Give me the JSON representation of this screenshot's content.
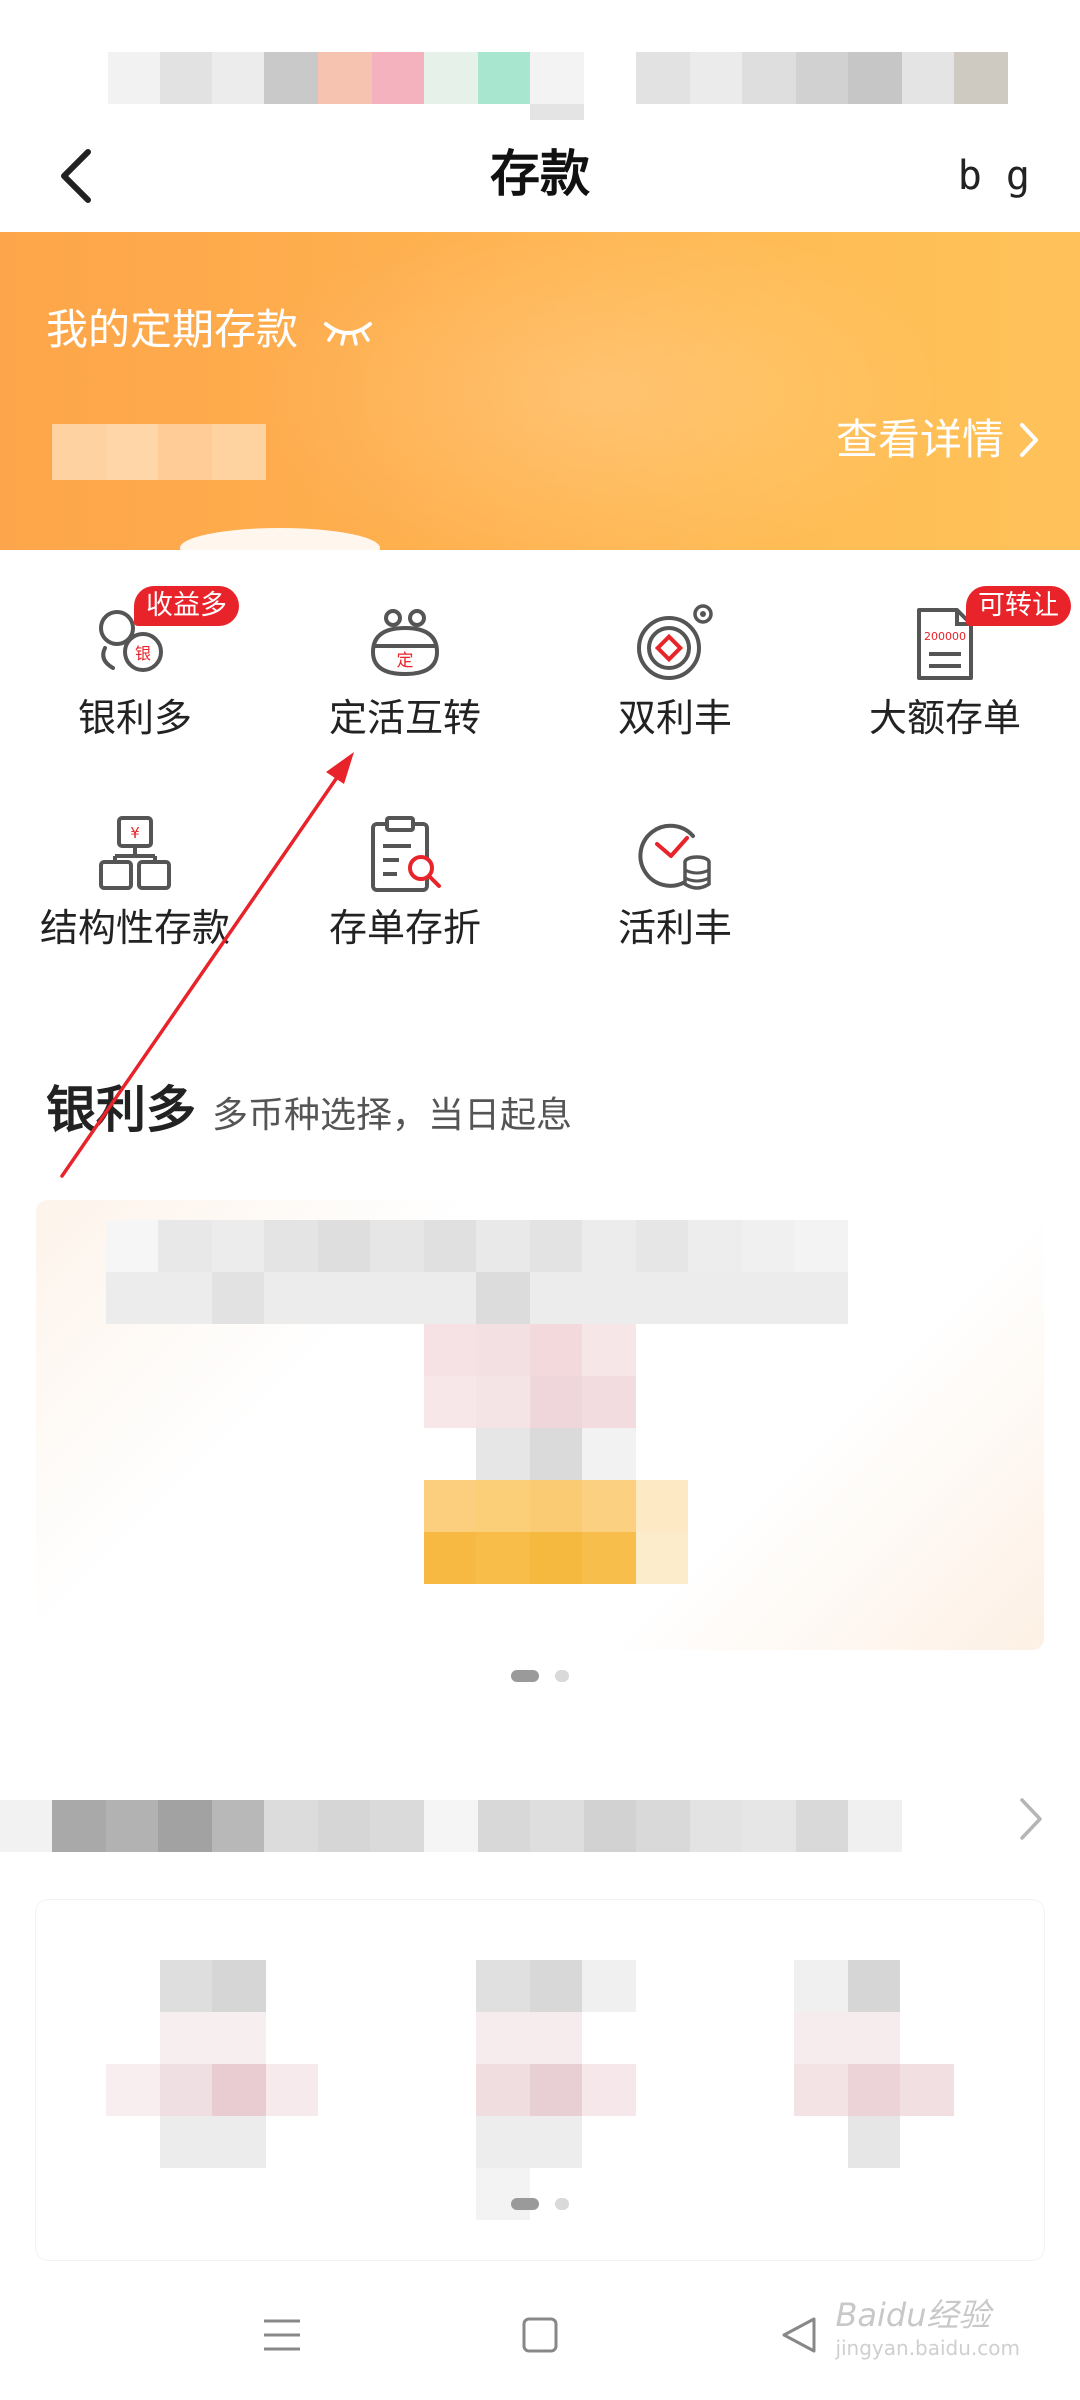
{
  "nav": {
    "title": "存款",
    "right_text": "b g"
  },
  "banner": {
    "title": "我的定期存款",
    "link_label": "查看详情",
    "gradient_start": "#fda54a",
    "gradient_end": "#ffc25a"
  },
  "grid": {
    "items": [
      {
        "label": "银利多",
        "icon": "coin-stack-icon",
        "badge": "收益多"
      },
      {
        "label": "定活互转",
        "icon": "purse-icon",
        "icon_text": "定"
      },
      {
        "label": "双利丰",
        "icon": "double-coin-icon"
      },
      {
        "label": "大额存单",
        "icon": "certificate-icon",
        "badge": "可转让",
        "icon_text": "200000"
      },
      {
        "label": "结构性存款",
        "icon": "structure-icon",
        "icon_text": "¥"
      },
      {
        "label": "存单存折",
        "icon": "passbook-search-icon"
      },
      {
        "label": "活利丰",
        "icon": "clock-coin-icon"
      }
    ]
  },
  "section": {
    "title": "银利多",
    "subtitle": "多币种选择，当日起息"
  },
  "watermark": {
    "brand": "Baidu经验",
    "url": "jingyan.baidu.com"
  },
  "colors": {
    "badge_red": "#e8232a",
    "annotation_red": "#e8232a",
    "icon_gray": "#555555"
  }
}
